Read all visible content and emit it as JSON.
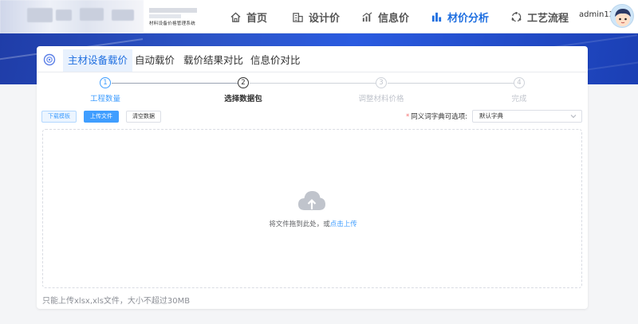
{
  "header": {
    "logo_subtitle": "材料设备价格管理系统",
    "user_name": "admin12"
  },
  "nav": {
    "items": [
      {
        "label": "首页",
        "icon": "home-icon"
      },
      {
        "label": "设计价",
        "icon": "building-icon"
      },
      {
        "label": "信息价",
        "icon": "bar-trend-icon"
      },
      {
        "label": "材价分析",
        "icon": "bar-chart-icon"
      },
      {
        "label": "工艺流程",
        "icon": "cycle-icon"
      }
    ],
    "active_index": 3,
    "active_color": "#1f6fe0"
  },
  "tabs": {
    "items": [
      "主材设备载价",
      "自动载价",
      "载价结果对比",
      "信息价对比"
    ],
    "active_index": 0
  },
  "steps": {
    "items": [
      {
        "num": "1",
        "label": "工程数量"
      },
      {
        "num": "2",
        "label": "选择数据包"
      },
      {
        "num": "3",
        "label": "调整材料价格"
      },
      {
        "num": "4",
        "label": "完成"
      }
    ],
    "current_index": 1
  },
  "toolbar": {
    "download_label": "下载模板",
    "upload_label": "上传文件",
    "clear_label": "清空数据",
    "dict_label": "同义词字典可选项:",
    "dict_value": "默认字典"
  },
  "upload": {
    "drop_text": "将文件拖到此处，或",
    "drop_link": "点击上传",
    "tip": "只能上传xlsx,xls文件，大小不超过30MB"
  },
  "colors": {
    "primary": "#409eff",
    "banner": "#2a55d0"
  }
}
